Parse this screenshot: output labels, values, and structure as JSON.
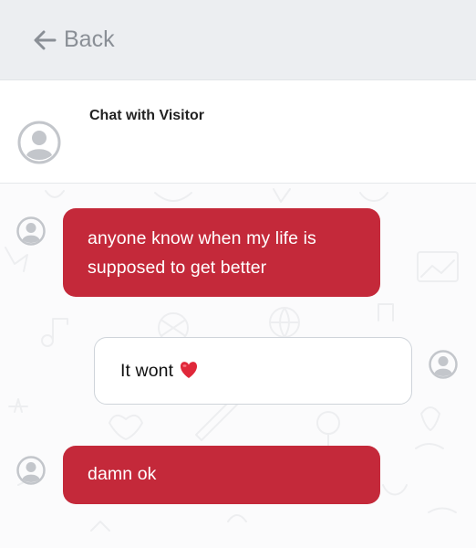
{
  "nav": {
    "back_label": "Back",
    "back_icon": "arrow-left-icon"
  },
  "header": {
    "title": "Chat with Visitor",
    "avatar_icon": "user-avatar-icon"
  },
  "colors": {
    "incoming_bubble": "#c4293a",
    "outgoing_bubble": "#ffffff",
    "topbar": "#eceef1",
    "avatar_gray": "#c3c6cb"
  },
  "messages": [
    {
      "sender": "visitor",
      "text": "anyone know when my life is supposed to get better"
    },
    {
      "sender": "agent",
      "text": "It wont",
      "emoji": "red-heart-icon"
    },
    {
      "sender": "visitor",
      "text": "damn ok"
    }
  ]
}
